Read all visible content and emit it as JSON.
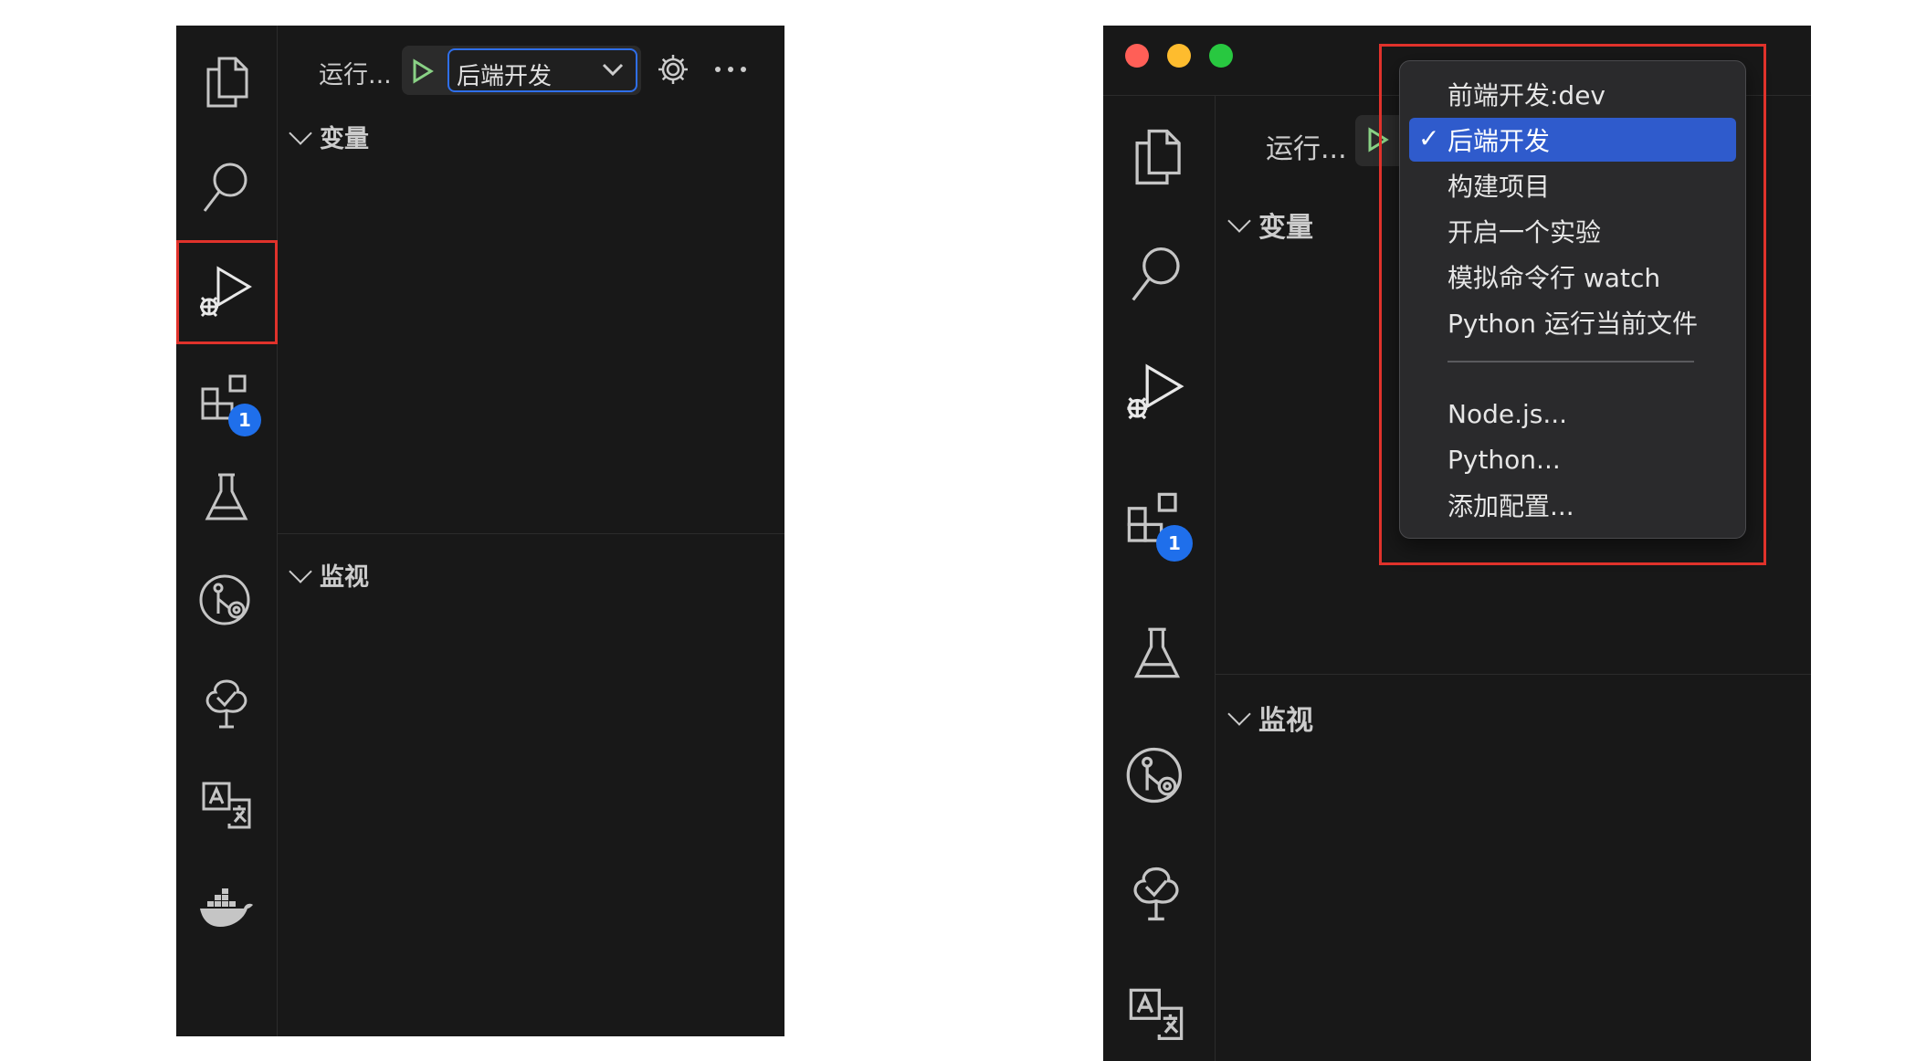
{
  "left_panel": {
    "run_label": "运行...",
    "config_selected": "后端开发",
    "extensions_badge": "1",
    "sections": {
      "variables": "变量",
      "watch": "监视"
    },
    "activity_icons": [
      "explorer-icon",
      "search-icon",
      "run-debug-icon",
      "extensions-icon",
      "testing-icon",
      "git-graph-icon",
      "tree-check-icon",
      "translate-icon",
      "docker-icon"
    ]
  },
  "right_panel": {
    "run_label": "运行...",
    "extensions_badge": "1",
    "sections": {
      "variables": "变量",
      "watch": "监视"
    },
    "window_dots": {
      "close": "#ff5f57",
      "minimize": "#febc2e",
      "maximize": "#28c840"
    },
    "dropdown": {
      "items": [
        "前端开发:dev",
        "后端开发",
        "构建项目",
        "开启一个实验",
        "模拟命令行 watch",
        "Python 运行当前文件"
      ],
      "selected_index": 1,
      "check_mark": "✓",
      "add_items": [
        "Node.js...",
        "Python...",
        "添加配置..."
      ]
    }
  },
  "colors": {
    "highlight_box": "#e0322b",
    "accent_blue": "#2f5bcc",
    "run_green": "#89d185",
    "badge": "#1f6feb",
    "background": "#181818"
  }
}
